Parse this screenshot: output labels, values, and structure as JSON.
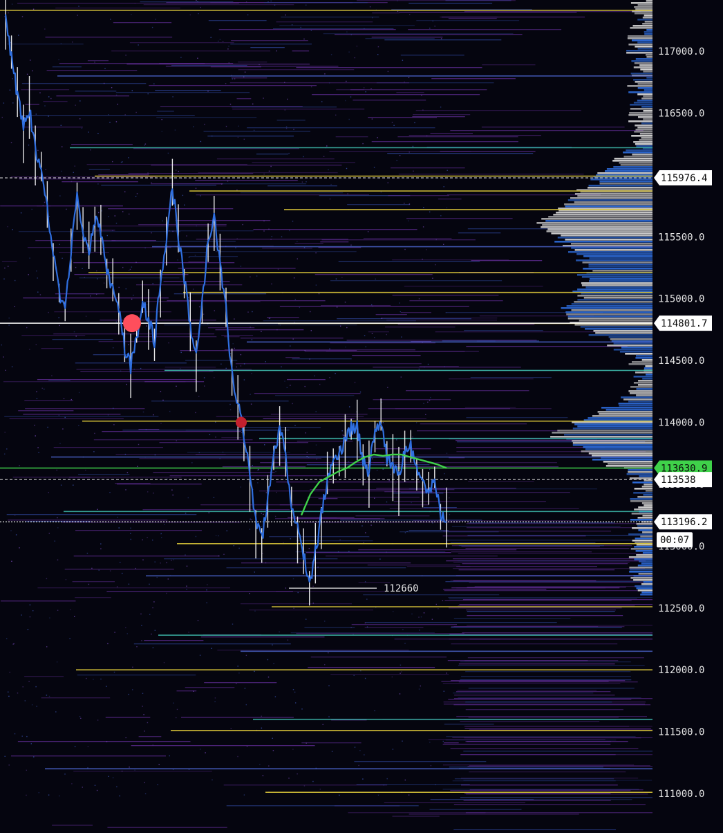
{
  "chart_data": {
    "type": "line",
    "title": "",
    "xlabel": "",
    "ylabel": "",
    "ylim": [
      110700,
      117400
    ],
    "y_axis": {
      "position": "right",
      "ticks": [
        111000,
        111500,
        112000,
        112500,
        113000,
        113500,
        114000,
        114500,
        115000,
        115500,
        116000,
        116500,
        117000
      ],
      "tick_labels": [
        "111000.0",
        "111500.0",
        "112000.0",
        "112500.0",
        "113000.0",
        "113500.0",
        "114000.0",
        "114500.0",
        "115000.0",
        "115500.0",
        "116000.0",
        "116500.0",
        "117000.0"
      ],
      "grid": false
    },
    "series": [
      {
        "kind": "price",
        "color": "#2f6fe0",
        "values": [
          117300,
          116950,
          116650,
          116400,
          116550,
          116200,
          116050,
          115700,
          115350,
          115050,
          114900,
          115400,
          115850,
          115550,
          115350,
          115650,
          115550,
          115250,
          115050,
          114900,
          114600,
          114450,
          114700,
          114950,
          114850,
          114650,
          115150,
          115500,
          115900,
          115500,
          115150,
          114800,
          114550,
          114950,
          115500,
          115650,
          115300,
          114900,
          114400,
          114150,
          113900,
          113550,
          113200,
          113050,
          113350,
          113750,
          113950,
          113750,
          113300,
          113150,
          112950,
          112700,
          112950,
          113250,
          113550,
          113650,
          113750,
          113850,
          113950,
          113950,
          113700,
          113600,
          113950,
          114000,
          113700,
          113650,
          113550,
          113750,
          113800,
          113600,
          113500,
          113400,
          113550,
          113250,
          113196.2
        ]
      },
      {
        "kind": "average",
        "color": "#3fd24a",
        "values": [
          113250,
          113420,
          113520,
          113560,
          113600,
          113630,
          113680,
          113720,
          113740,
          113730,
          113740,
          113740,
          113720,
          113700,
          113680,
          113660,
          113630.9
        ]
      }
    ],
    "reference_lines": [
      {
        "value": 115976.4,
        "label": "115976.4",
        "style": "dashed",
        "color": "#d8d8d8"
      },
      {
        "value": 114801.7,
        "label": "114801.7",
        "style": "solid",
        "color": "#ffffff"
      },
      {
        "value": 113630.9,
        "label": "113630.9",
        "style": "solid",
        "color": "#3fd24a"
      },
      {
        "value": 113538,
        "label": "113538",
        "style": "dashed",
        "color": "#d8d8d8"
      },
      {
        "value": 113196.2,
        "label": "113196.2",
        "style": "dotted",
        "color": "#ffffff"
      }
    ],
    "annotations": [
      {
        "type": "low-marker",
        "value": 112660,
        "label": "112660"
      },
      {
        "type": "countdown",
        "label": "00:07"
      },
      {
        "type": "marker",
        "value": 114801.7,
        "color": "#ff4e5c",
        "size": "large"
      },
      {
        "type": "marker",
        "value": 114000,
        "color": "#c4202e",
        "size": "small"
      }
    ],
    "orderbook_levels": [
      {
        "value": 117330,
        "color": "#e8d23c"
      },
      {
        "value": 115990,
        "color": "#e8d23c"
      },
      {
        "value": 115870,
        "color": "#e8d23c"
      },
      {
        "value": 115720,
        "color": "#e8d23c"
      },
      {
        "value": 115210,
        "color": "#e8d23c"
      },
      {
        "value": 115050,
        "color": "#e8d23c"
      },
      {
        "value": 114800,
        "color": "#e8d23c"
      },
      {
        "value": 114010,
        "color": "#e8d23c"
      },
      {
        "value": 113020,
        "color": "#e8d23c"
      },
      {
        "value": 112510,
        "color": "#e8d23c"
      },
      {
        "value": 112000,
        "color": "#e8d23c"
      },
      {
        "value": 111510,
        "color": "#e8d23c"
      },
      {
        "value": 111010,
        "color": "#e8d23c"
      },
      {
        "value": 116220,
        "color": "#3fbfb0"
      },
      {
        "value": 114420,
        "color": "#3fbfb0"
      },
      {
        "value": 113870,
        "color": "#3fbfb0"
      },
      {
        "value": 113280,
        "color": "#3fbfb0"
      },
      {
        "value": 112280,
        "color": "#3fbfb0"
      },
      {
        "value": 111600,
        "color": "#3fbfb0"
      },
      {
        "value": 116800,
        "color": "#4a62c8"
      },
      {
        "value": 115420,
        "color": "#4a62c8"
      },
      {
        "value": 114650,
        "color": "#4a62c8"
      },
      {
        "value": 113720,
        "color": "#4a62c8"
      },
      {
        "value": 112760,
        "color": "#4a62c8"
      },
      {
        "value": 112150,
        "color": "#4a62c8"
      },
      {
        "value": 111200,
        "color": "#4a62c8"
      }
    ],
    "volume_profile": {
      "colors": [
        "#d8d8d8",
        "#2f6fe0"
      ]
    },
    "colors": {
      "background": "#05050f",
      "price": "#2f6fe0",
      "wick": "#ffffff",
      "average": "#3fd24a",
      "level": "#e8d23c",
      "heatmap": "#5a2a8c"
    }
  }
}
